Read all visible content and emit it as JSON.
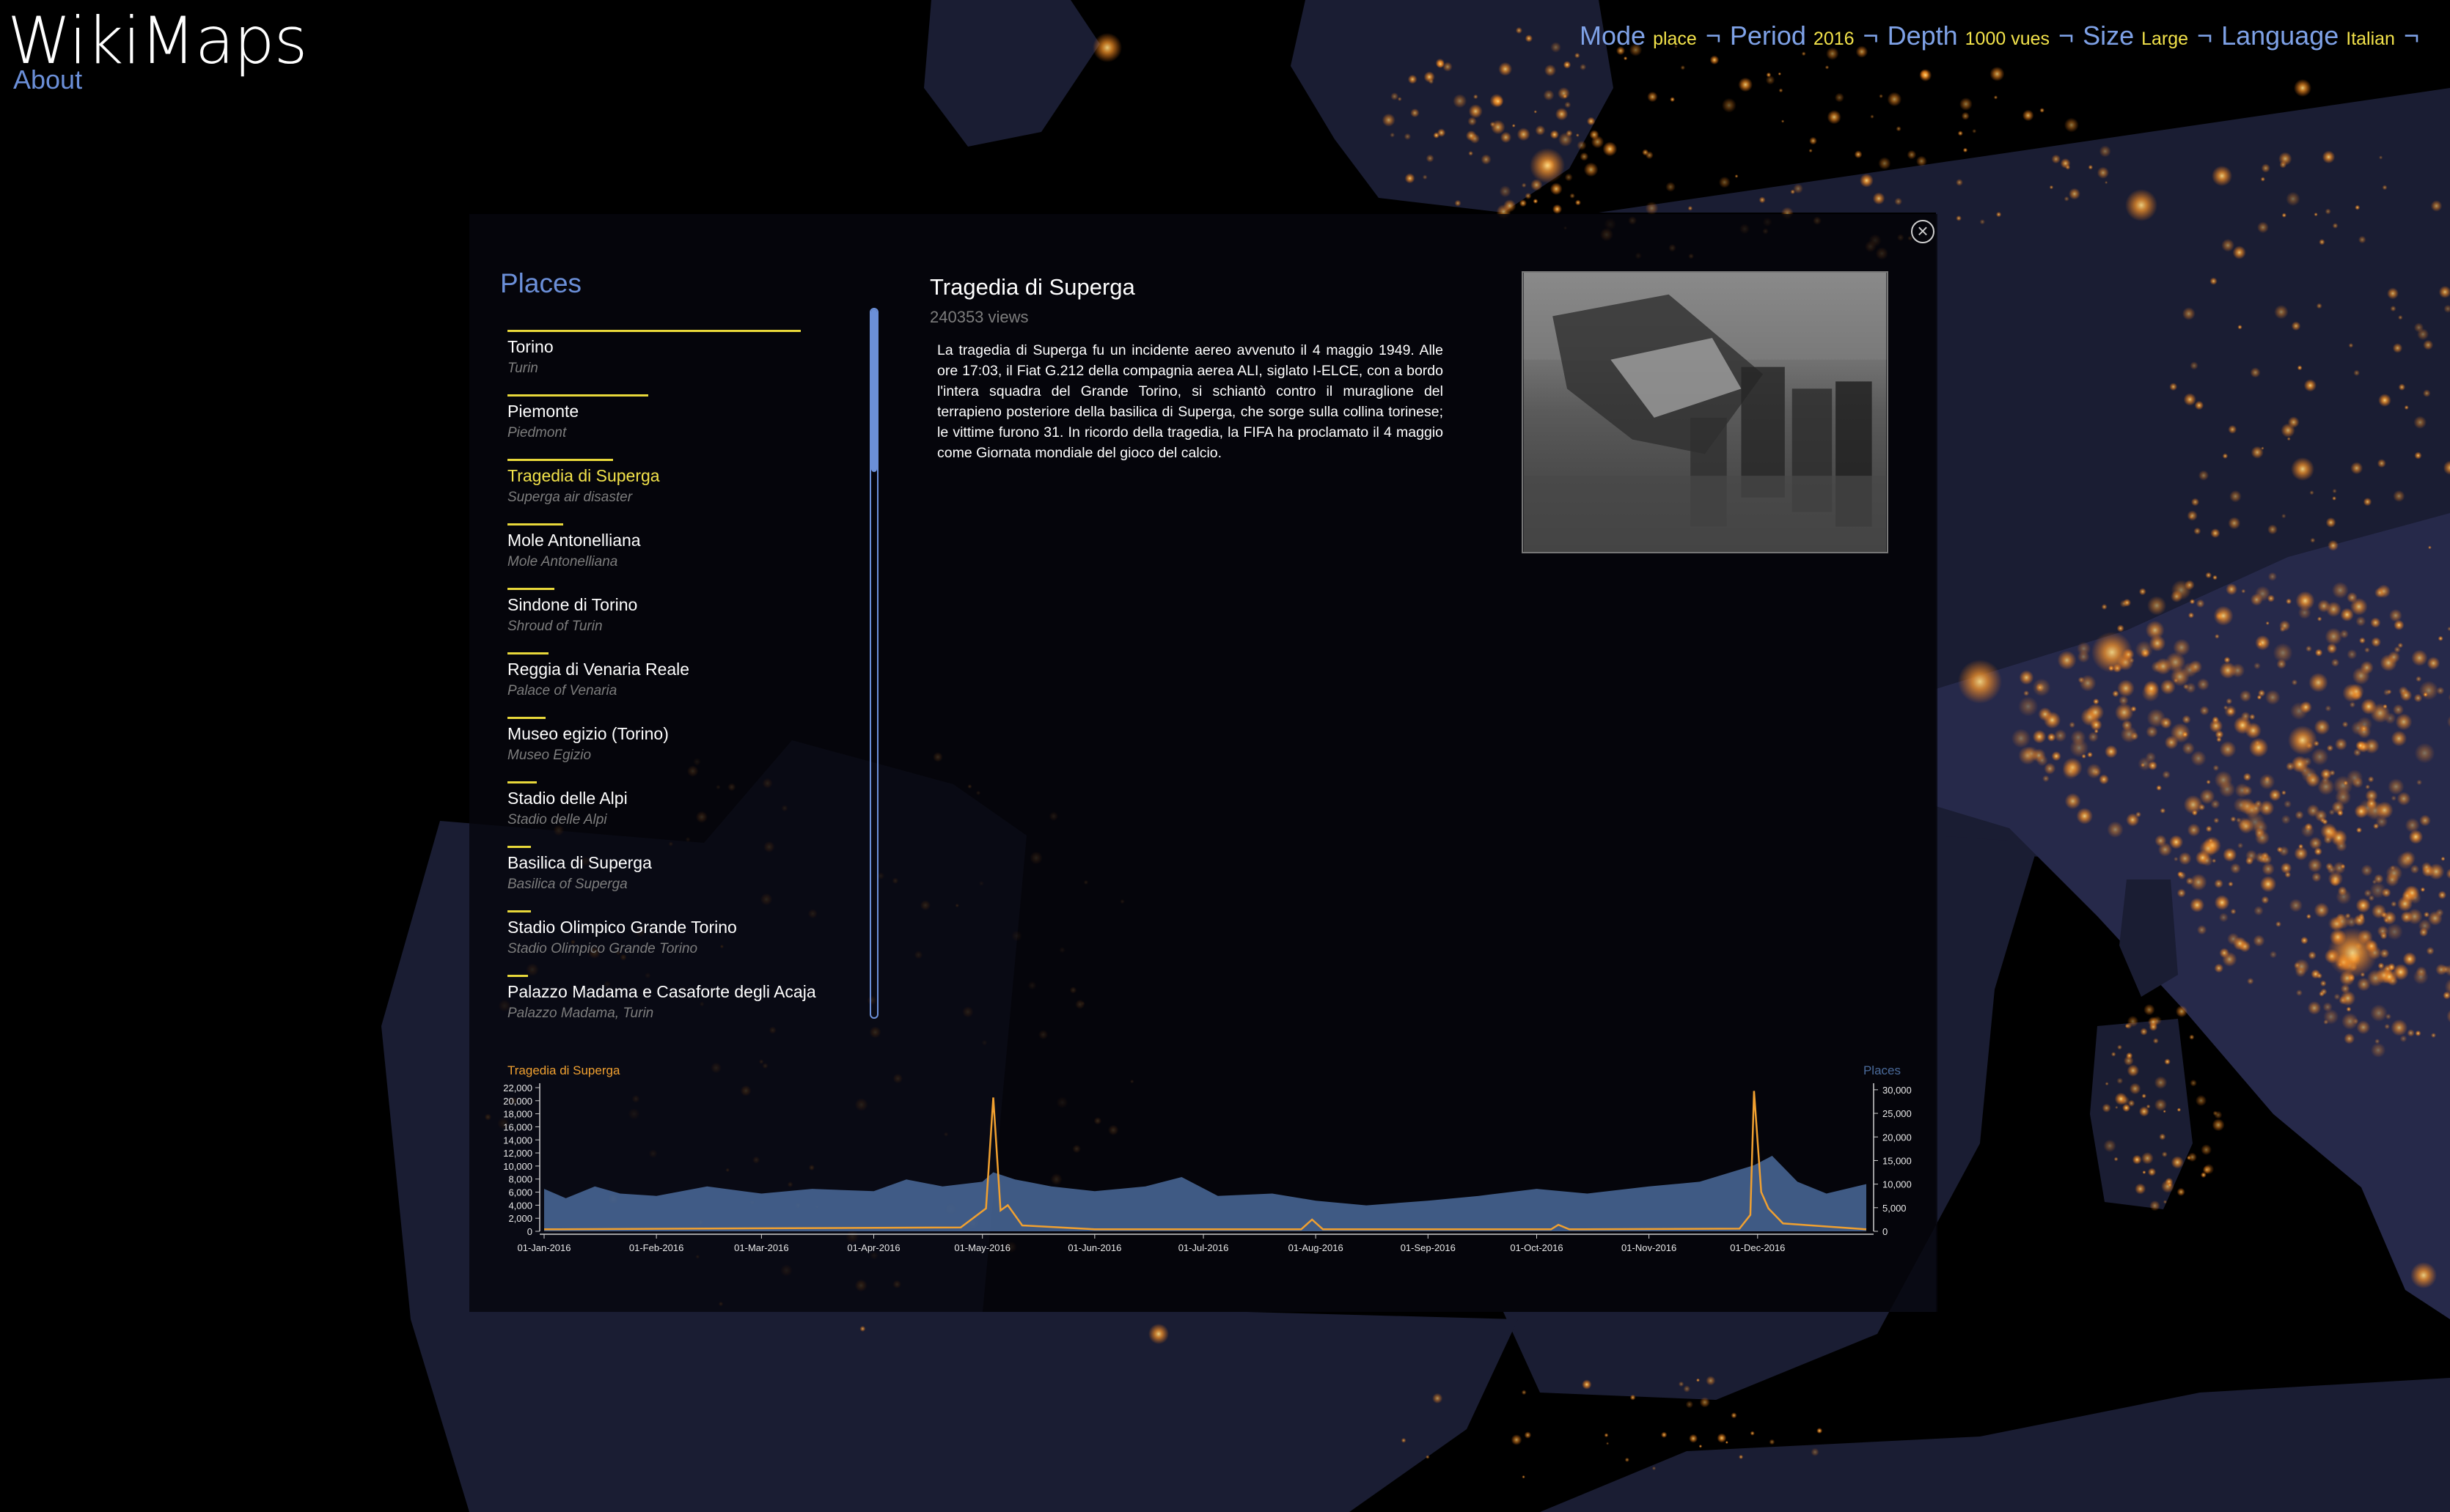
{
  "app": {
    "title": "WikiMaps",
    "about_label": "About"
  },
  "topnav": {
    "separator": "¬",
    "items": [
      {
        "key": "Mode",
        "value": "place"
      },
      {
        "key": "Period",
        "value": "2016"
      },
      {
        "key": "Depth",
        "value": "1000 vues"
      },
      {
        "key": "Size",
        "value": "Large"
      },
      {
        "key": "Language",
        "value": "Italian"
      }
    ],
    "trailing": "¬"
  },
  "panel": {
    "close_icon": "close-circle-icon",
    "places_title": "Places",
    "places": [
      {
        "name": "Torino",
        "sub": "Turin",
        "bar": 1.0
      },
      {
        "name": "Piemonte",
        "sub": "Piedmont",
        "bar": 0.48
      },
      {
        "name": "Tragedia di Superga",
        "sub": "Superga air disaster",
        "bar": 0.36,
        "active": true
      },
      {
        "name": "Mole Antonelliana",
        "sub": "Mole Antonelliana",
        "bar": 0.19
      },
      {
        "name": "Sindone di Torino",
        "sub": "Shroud of Turin",
        "bar": 0.16
      },
      {
        "name": "Reggia di Venaria Reale",
        "sub": "Palace of Venaria",
        "bar": 0.14
      },
      {
        "name": "Museo egizio (Torino)",
        "sub": "Museo Egizio",
        "bar": 0.13
      },
      {
        "name": "Stadio delle Alpi",
        "sub": "Stadio delle Alpi",
        "bar": 0.1
      },
      {
        "name": "Basilica di Superga",
        "sub": "Basilica of Superga",
        "bar": 0.08
      },
      {
        "name": "Stadio Olimpico Grande Torino",
        "sub": "Stadio Olimpico Grande Torino",
        "bar": 0.08
      },
      {
        "name": "Palazzo Madama e Casaforte degli Acaja",
        "sub": "Palazzo Madama, Turin",
        "bar": 0.07
      }
    ],
    "article": {
      "title": "Tragedia di Superga",
      "views": "240353 views",
      "text": "La tragedia di Superga fu un incidente aereo avvenuto il 4 maggio 1949. Alle ore 17:03, il Fiat G.212 della compagnia aerea ALI, siglato I-ELCE, con a bordo l'intera squadra del Grande Torino, si schiantò contro il muraglione del terrapieno posteriore della basilica di Superga, che sorge sulla collina torinese; le vittime furono 31. In ricordo della tragedia, la FIFA ha proclamato il 4 maggio come Giornata mondiale del gioco del calcio."
    }
  },
  "chart_data": {
    "type": "line",
    "series": [
      {
        "name": "Tragedia di Superga",
        "color": "#f0a030",
        "axis": "left"
      },
      {
        "name": "Places",
        "color": "#4a6a9a",
        "axis": "right",
        "style": "area"
      }
    ],
    "x_range": [
      "2016-01-01",
      "2016-12-31"
    ],
    "x_ticks": [
      "01-Jan-2016",
      "01-Feb-2016",
      "01-Mar-2016",
      "01-Apr-2016",
      "01-May-2016",
      "01-Jun-2016",
      "01-Jul-2016",
      "01-Aug-2016",
      "01-Sep-2016",
      "01-Oct-2016",
      "01-Nov-2016",
      "01-Dec-2016"
    ],
    "left_ylim": [
      0,
      22000
    ],
    "left_ticks": [
      "0",
      "2,000",
      "4,000",
      "6,000",
      "8,000",
      "10,000",
      "12,000",
      "14,000",
      "16,000",
      "18,000",
      "20,000",
      "22,000"
    ],
    "right_ylim": [
      0,
      32000
    ],
    "right_ticks": [
      "0",
      "5,000",
      "10,000",
      "15,000",
      "20,000",
      "25,000",
      "30,000"
    ],
    "superga_points": [
      [
        "2016-01-01",
        300
      ],
      [
        "2016-04-25",
        600
      ],
      [
        "2016-05-02",
        3500
      ],
      [
        "2016-05-04",
        20500
      ],
      [
        "2016-05-06",
        3200
      ],
      [
        "2016-05-08",
        4000
      ],
      [
        "2016-05-12",
        900
      ],
      [
        "2016-06-01",
        300
      ],
      [
        "2016-07-28",
        300
      ],
      [
        "2016-07-31",
        1800
      ],
      [
        "2016-08-03",
        300
      ],
      [
        "2016-10-05",
        300
      ],
      [
        "2016-10-07",
        1000
      ],
      [
        "2016-10-10",
        300
      ],
      [
        "2016-11-26",
        400
      ],
      [
        "2016-11-29",
        2500
      ],
      [
        "2016-11-30",
        21500
      ],
      [
        "2016-12-02",
        6000
      ],
      [
        "2016-12-04",
        3500
      ],
      [
        "2016-12-08",
        1200
      ],
      [
        "2016-12-31",
        300
      ]
    ],
    "places_points": [
      [
        "2016-01-01",
        9000
      ],
      [
        "2016-01-07",
        7000
      ],
      [
        "2016-01-15",
        9500
      ],
      [
        "2016-01-22",
        8000
      ],
      [
        "2016-02-01",
        7500
      ],
      [
        "2016-02-15",
        9500
      ],
      [
        "2016-03-01",
        8000
      ],
      [
        "2016-03-15",
        9000
      ],
      [
        "2016-04-01",
        8500
      ],
      [
        "2016-04-10",
        11000
      ],
      [
        "2016-04-20",
        9500
      ],
      [
        "2016-05-01",
        10500
      ],
      [
        "2016-05-04",
        12500
      ],
      [
        "2016-05-10",
        11000
      ],
      [
        "2016-05-20",
        9500
      ],
      [
        "2016-06-01",
        8500
      ],
      [
        "2016-06-15",
        9500
      ],
      [
        "2016-06-25",
        11500
      ],
      [
        "2016-07-05",
        7500
      ],
      [
        "2016-07-20",
        8000
      ],
      [
        "2016-08-01",
        6500
      ],
      [
        "2016-08-15",
        5500
      ],
      [
        "2016-09-01",
        6500
      ],
      [
        "2016-09-15",
        7500
      ],
      [
        "2016-10-01",
        9000
      ],
      [
        "2016-10-15",
        8000
      ],
      [
        "2016-11-01",
        9500
      ],
      [
        "2016-11-15",
        10500
      ],
      [
        "2016-11-30",
        14000
      ],
      [
        "2016-12-05",
        16000
      ],
      [
        "2016-12-12",
        10500
      ],
      [
        "2016-12-20",
        8000
      ],
      [
        "2016-12-31",
        10000
      ]
    ]
  }
}
